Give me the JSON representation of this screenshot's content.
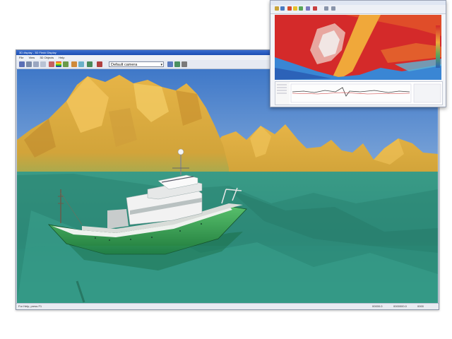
{
  "window": {
    "title": "3D display - 3D Fledd Display",
    "menu": [
      "File",
      "View",
      "3D Objects",
      "Help"
    ]
  },
  "toolbar": {
    "camera_select": "Default camera",
    "icons": [
      "cube-icon",
      "pointer-icon",
      "rotate-icon",
      "pan-icon",
      "zoom-icon",
      "color-scale-icon",
      "terrain-icon",
      "pencil-icon",
      "measure-icon",
      "ship-icon",
      "settings-icon",
      "refresh-icon",
      "camera-icon"
    ]
  },
  "status": {
    "left": "For Help, press F1",
    "right1": "00000.0",
    "right2": "0000000.0",
    "right3": "0000"
  },
  "scene": {
    "water_color": "#2a8f7a",
    "terrain_color": "#d9a63a",
    "sky_color": "#5b8fd6",
    "vessel_color": "#2f9b52"
  },
  "inset": {
    "map_colors": [
      "#d3262a",
      "#e9882a",
      "#3b8cd7",
      "#e8e2e0"
    ]
  }
}
